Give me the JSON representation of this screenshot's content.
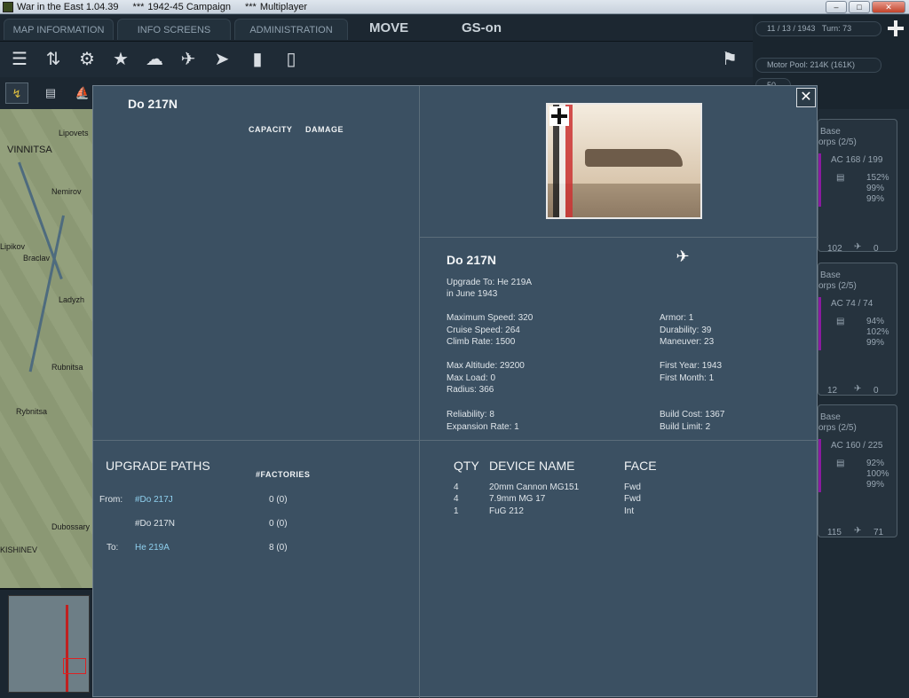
{
  "window": {
    "title": "War in the East 1.04.39",
    "campaign": "1942-45 Campaign",
    "mode": "Multiplayer",
    "sep1": "***",
    "sep2": "***"
  },
  "menu": {
    "tabs": [
      "MAP INFORMATION",
      "INFO SCREENS",
      "ADMINISTRATION"
    ],
    "move": "MOVE",
    "gs": "GS-on"
  },
  "toolbar_icons": [
    "list-icon",
    "units-icon",
    "gear-icon",
    "star-icon",
    "weather-icon",
    "air-icon",
    "rocket-icon",
    "report-icon",
    "document-icon",
    "flag-icon"
  ],
  "status": {
    "date": "11 / 13 / 1943",
    "turn": "Turn: 73",
    "motor_pool": "Motor Pool: 214K (161K)",
    "small_value": "50"
  },
  "map": {
    "labels": [
      "Lipovets",
      "VINNITSA",
      "Nemirov",
      "Lipikov",
      "Braclav",
      "Ladyzh",
      "Rubnitsa",
      "Rybnitsa",
      "Dubossary",
      "KISHINEV"
    ]
  },
  "unit_cards": [
    {
      "base": "Base",
      "corps": "orps  (2/5)",
      "ac": "AC  168 / 199",
      "p1": "152%",
      "p2": "99%",
      "p3": "99%",
      "left_count": "102",
      "right_count": "0"
    },
    {
      "base": "Base",
      "corps": "orps  (2/5)",
      "ac": "AC  74 / 74",
      "p1": "94%",
      "p2": "102%",
      "p3": "99%",
      "left_count": "12",
      "right_count": "0"
    },
    {
      "base": "Base",
      "corps": "orps  (2/5)",
      "ac": "AC  160 / 225",
      "p1": "92%",
      "p2": "100%",
      "p3": "99%",
      "left_count": "115",
      "right_count": "71"
    }
  ],
  "dialog": {
    "left_title": "Do 217N",
    "capacity_header": "CAPACITY",
    "damage_header": "DAMAGE",
    "detail_title": "Do 217N",
    "upgrade_to": "Upgrade To: He 219A",
    "upgrade_date": "in June 1943",
    "stats_left": [
      "Maximum Speed: 320",
      "Cruise Speed: 264",
      "Climb Rate: 1500",
      "Max Altitude: 29200",
      "Max Load: 0",
      "Radius: 366",
      "Reliability: 8",
      "Expansion Rate: 1"
    ],
    "stats_right": [
      "Armor: 1",
      "Durability: 39",
      "Maneuver: 23",
      "First Year: 1943",
      "First Month: 1",
      "Build Cost: 1367",
      "Build Limit: 2"
    ],
    "upgrade_paths_header": "UPGRADE PATHS",
    "factories_header": "#FACTORIES",
    "from_label": "From:",
    "to_label": "To:",
    "paths": [
      {
        "name": "#Do 217J",
        "factories": "0 (0)"
      },
      {
        "name": "#Do 217N",
        "factories": "0 (0)"
      },
      {
        "name": "He 219A",
        "factories": "8 (0)"
      }
    ],
    "device_headers": {
      "qty": "QTY",
      "name": "DEVICE NAME",
      "face": "FACE"
    },
    "devices": [
      {
        "qty": "4",
        "name": "20mm Cannon MG151",
        "face": "Fwd"
      },
      {
        "qty": "4",
        "name": "7.9mm MG 17",
        "face": "Fwd"
      },
      {
        "qty": "1",
        "name": "FuG 212",
        "face": "Int"
      }
    ]
  }
}
